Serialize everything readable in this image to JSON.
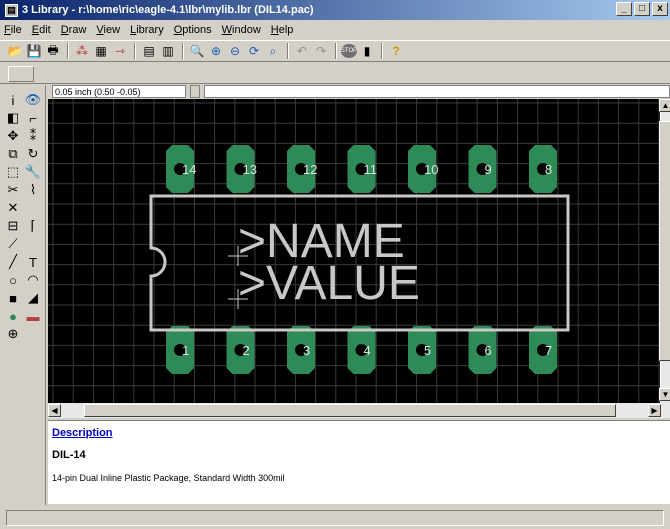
{
  "window": {
    "title": "3 Library - r:\\home\\ric\\eagle-4.1\\lbr\\mylib.lbr (DIL14.pac)",
    "minimize": "_",
    "maximize": "□",
    "close": "x"
  },
  "menu": [
    "File",
    "Edit",
    "Draw",
    "View",
    "Library",
    "Options",
    "Window",
    "Help"
  ],
  "toolbar": {
    "icons": [
      "open-icon",
      "save-icon",
      "print-icon",
      "sep",
      "pinswap-icon",
      "table-icon",
      "pin-icon",
      "sep",
      "script-icon",
      "run-icon",
      "sep",
      "zoom-fit-icon",
      "zoom-in-icon",
      "zoom-out-icon",
      "zoom-redraw-icon",
      "zoom-select-icon",
      "sep",
      "undo-icon",
      "redo-icon",
      "sep",
      "stop-icon",
      "go-icon",
      "sep",
      "help-icon"
    ],
    "glyphs": {
      "open-icon": "📂",
      "save-icon": "💾",
      "print-icon": "🖶",
      "pinswap-icon": "⁂",
      "table-icon": "▦",
      "pin-icon": "⇾",
      "script-icon": "▤",
      "run-icon": "▥",
      "zoom-fit-icon": "🔍",
      "zoom-in-icon": "⊕",
      "zoom-out-icon": "⊖",
      "zoom-redraw-icon": "⟳",
      "zoom-select-icon": "⌕",
      "undo-icon": "↶",
      "redo-icon": "↷",
      "stop-icon": "STOP",
      "go-icon": "▮",
      "help-icon": "?"
    }
  },
  "coords": {
    "value": "0.05 inch (0.50 -0.05)",
    "command_value": ""
  },
  "lefttools": [
    {
      "name": "info-icon",
      "glyph": "i"
    },
    {
      "name": "show-icon",
      "glyph": "👁"
    },
    {
      "name": "display-icon",
      "glyph": "◧"
    },
    {
      "name": "mark-icon",
      "glyph": "⌐"
    },
    {
      "name": "move-icon",
      "glyph": "✥"
    },
    {
      "name": "copy-icon",
      "glyph": "⁑"
    },
    {
      "name": "mirror-icon",
      "glyph": "⧉"
    },
    {
      "name": "rotate-icon",
      "glyph": "↻"
    },
    {
      "name": "group-icon",
      "glyph": "⬚"
    },
    {
      "name": "change-icon",
      "glyph": "🔧"
    },
    {
      "name": "cut-icon",
      "glyph": "✂"
    },
    {
      "name": "paste-icon",
      "glyph": "⌇"
    },
    {
      "name": "delete-icon",
      "glyph": "✕"
    },
    {
      "name": "blank-1",
      "glyph": ""
    },
    {
      "name": "name-icon",
      "glyph": "⊟"
    },
    {
      "name": "miter-icon",
      "glyph": "⌈"
    },
    {
      "name": "split-icon",
      "glyph": "⟋"
    },
    {
      "name": "blank-2",
      "glyph": ""
    },
    {
      "name": "wire-icon",
      "glyph": "╱"
    },
    {
      "name": "text-icon",
      "glyph": "T"
    },
    {
      "name": "circle-icon",
      "glyph": "○"
    },
    {
      "name": "arc-icon",
      "glyph": "◠"
    },
    {
      "name": "rect-icon",
      "glyph": "■"
    },
    {
      "name": "polygon-icon",
      "glyph": "◢"
    },
    {
      "name": "pad-icon",
      "glyph": "●"
    },
    {
      "name": "smd-icon",
      "glyph": "▬"
    },
    {
      "name": "hole-icon",
      "glyph": "⊕"
    },
    {
      "name": "blank-3",
      "glyph": ""
    }
  ],
  "package": {
    "pins_bottom": [
      "1",
      "2",
      "3",
      "4",
      "5",
      "6",
      "7"
    ],
    "pins_top": [
      "14",
      "13",
      "12",
      "11",
      "10",
      "9",
      "8"
    ],
    "name_text": ">NAME",
    "value_text": ">VALUE",
    "pad_color": "#2e8b57",
    "outline_color": "#c8c8c8"
  },
  "description": {
    "title": "Description",
    "name": "DIL-14",
    "text": "14-pin Dual Inline Plastic Package, Standard Width 300mil"
  },
  "status": ""
}
